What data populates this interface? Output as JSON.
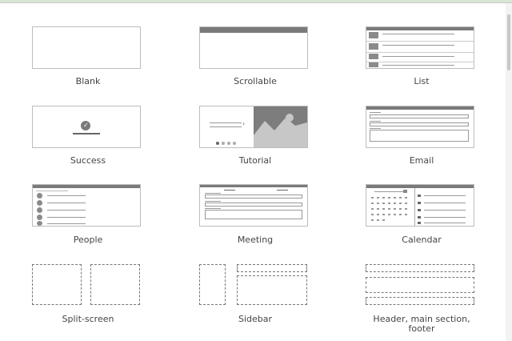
{
  "templates": [
    {
      "id": "blank",
      "label": "Blank",
      "icon": "blank-template-icon"
    },
    {
      "id": "scrollable",
      "label": "Scrollable",
      "icon": "scrollable-template-icon"
    },
    {
      "id": "list",
      "label": "List",
      "icon": "list-template-icon"
    },
    {
      "id": "success",
      "label": "Success",
      "icon": "success-template-icon"
    },
    {
      "id": "tutorial",
      "label": "Tutorial",
      "icon": "tutorial-template-icon"
    },
    {
      "id": "email",
      "label": "Email",
      "icon": "email-template-icon"
    },
    {
      "id": "people",
      "label": "People",
      "icon": "people-template-icon"
    },
    {
      "id": "meeting",
      "label": "Meeting",
      "icon": "meeting-template-icon"
    },
    {
      "id": "calendar",
      "label": "Calendar",
      "icon": "calendar-template-icon"
    },
    {
      "id": "split_screen",
      "label": "Split-screen",
      "icon": "split-screen-template-icon"
    },
    {
      "id": "sidebar",
      "label": "Sidebar",
      "icon": "sidebar-template-icon"
    },
    {
      "id": "header_main_footer",
      "label": "Header, main section, footer",
      "icon": "header-main-footer-template-icon"
    }
  ],
  "colors": {
    "border": "#bdbdbd",
    "accent_bar": "#7a7a7a",
    "label": "#444444"
  }
}
